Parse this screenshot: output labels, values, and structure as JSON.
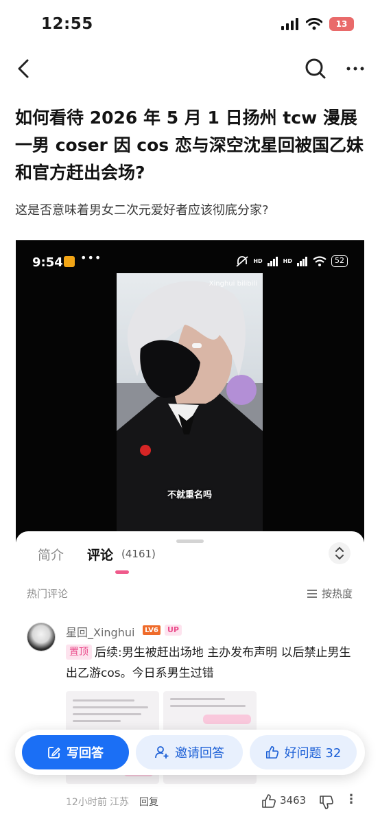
{
  "status_bar": {
    "time": "12:55",
    "battery": "13"
  },
  "nav": {
    "back_icon": "chevron-left-icon",
    "search_icon": "search-icon",
    "more_icon": "more-icon"
  },
  "question": {
    "title": "如何看待 2026 年 5 月 1 日扬州 tcw 漫展一男 coser 因 cos 恋与深空沈星回被国乙妹和官方赶出会场?",
    "description": "这是否意味着男女二次元爱好者应该彻底分家?"
  },
  "video": {
    "status_time": "9:54",
    "dots": "•••",
    "battery": "52",
    "hd1": "HD",
    "hd2": "HD",
    "watermark": "Xinghui",
    "bili_logo": "bilibili",
    "subtitle": "不就重名吗"
  },
  "sheet": {
    "tab_intro": "简介",
    "tab_comments": "评论",
    "comment_count": "(4161)",
    "hot_label": "热门评论",
    "sort_label": "按热度",
    "accent": "#ef5a8b"
  },
  "comment": {
    "username": "星回_Xinghui",
    "level_badge": "LV6",
    "up_badge": "UP",
    "pin_tag": "置顶",
    "text": "后续:男生被赶出场地 主办发布声明 以后禁止男生出乙游cos。今日系男生过错",
    "time": "12小时前",
    "location": "江苏",
    "reply": "回复",
    "likes": "3463",
    "more": "⋮"
  },
  "actions": {
    "answer": "写回答",
    "invite": "邀请回答",
    "good_question": "好问题 32",
    "primary_color": "#1b6ff5"
  }
}
